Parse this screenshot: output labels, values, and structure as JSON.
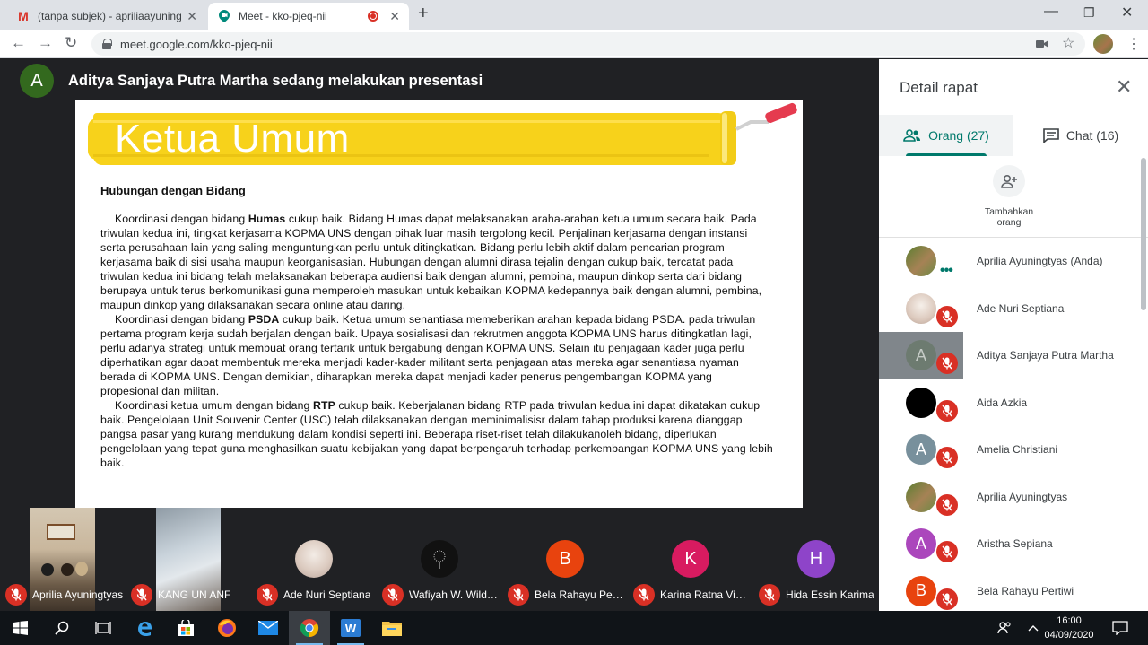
{
  "browser": {
    "tabs": [
      {
        "title": "(tanpa subjek) - apriliaayuningtyas",
        "icon": "gmail-icon",
        "active": false
      },
      {
        "title": "Meet - kko-pjeq-nii",
        "icon": "meet-icon",
        "active": true
      }
    ],
    "url": "meet.google.com/kko-pjeq-nii"
  },
  "stage": {
    "presenter_initial": "A",
    "presenter_text": "Aditya Sanjaya Putra Martha sedang melakukan presentasi"
  },
  "slide": {
    "banner_title": "Ketua Umum",
    "heading": "Hubungan dengan Bidang",
    "p1": {
      "a": "Koordinasi dengan bidang ",
      "b": "Humas",
      "c": " cukup baik. Bidang Humas dapat melaksanakan araha-arahan ketua umum secara baik. Pada triwulan kedua ini, tingkat kerjasama KOPMA UNS dengan pihak luar masih tergolong kecil. Penjalinan kerjasama dengan instansi serta perusahaan lain yang saling menguntungkan perlu untuk ditingkatkan. Bidang perlu lebih aktif dalam pencarian program kerjasama baik di sisi usaha maupun keorganisasian. Hubungan dengan alumni dirasa tejalin dengan cukup baik, tercatat pada triwulan kedua ini bidang telah melaksanakan beberapa audiensi baik dengan alumni, pembina, maupun dinkop serta dari bidang berupaya untuk terus berkomunikasi guna memperoleh masukan untuk kebaikan KOPMA kedepannya baik dengan alumni, pembina, maupun dinkop yang dilaksanakan secara online atau daring."
    },
    "p2": {
      "a": "Koordinasi dengan bidang ",
      "b": "PSDA",
      "c": " cukup baik. Ketua umum senantiasa memeberikan arahan kepada bidang PSDA. pada triwulan pertama program kerja sudah berjalan dengan baik. Upaya sosialisasi dan rekrutmen anggota KOPMA UNS harus ditingkatlan lagi, perlu adanya strategi untuk membuat orang tertarik untuk bergabung dengan KOPMA UNS. Selain itu penjagaan kader juga perlu diperhatikan agar dapat membentuk mereka menjadi kader-kader militant serta penjagaan atas mereka agar senantiasa nyaman berada di KOPMA UNS. Dengan demikian, diharapkan mereka dapat menjadi kader penerus pengembangan KOPMA yang propesional dan militan."
    },
    "p3": {
      "a": "Koordinasi ketua umum dengan bidang ",
      "b": "RTP",
      "c": " cukup baik. Keberjalanan bidang RTP pada triwulan kedua ini dapat dikatakan cukup baik. Pengelolaan Unit Souvenir Center (USC) telah dilaksanakan dengan meminimalisisr dalam tahap produksi karena dianggap pangsa pasar yang kurang mendukung dalam kondisi seperti ini. Beberapa riset-riset telah dilakukanoleh bidang, diperlukan pengelolaan yang tepat guna menghasilkan suatu kebijakan yang dapat berpengaruh terhadap perkembangan KOPMA UNS yang lebih baik."
    }
  },
  "filmstrip": [
    {
      "name": "Aprilia Ayuningtyas",
      "type": "video",
      "color": "#8a7a66"
    },
    {
      "name": "KANG UN ANF",
      "type": "video",
      "color": "#b7c4cf"
    },
    {
      "name": "Ade Nuri Septiana",
      "type": "photo",
      "color": "#e8dcd4"
    },
    {
      "name": "Wafiyah W. Wildana",
      "type": "photo",
      "color": "#111111"
    },
    {
      "name": "Bela Rahayu Pertiwi",
      "type": "initial",
      "initial": "B",
      "color": "#e8430e"
    },
    {
      "name": "Karina Ratna Vinanda",
      "type": "initial",
      "initial": "K",
      "color": "#d81b60"
    },
    {
      "name": "Hida Essin Karima",
      "type": "initial",
      "initial": "H",
      "color": "#8e44c9"
    }
  ],
  "panel": {
    "title": "Detail rapat",
    "tab_people": "Orang (27)",
    "tab_chat": "Chat (16)",
    "add_label_1": "Tambahkan",
    "add_label_2": "orang",
    "participants": [
      {
        "name": "Aprilia Ayuningtyas (Anda)",
        "type": "photo",
        "color": "#6b8e3a",
        "muted": false
      },
      {
        "name": "Ade Nuri Septiana",
        "type": "photo",
        "color": "#e8dcd4",
        "muted": true
      },
      {
        "name": "Aditya Sanjaya Putra Martha",
        "type": "initial",
        "initial": "A",
        "color": "#6d7b70",
        "muted": true,
        "highlighted": true
      },
      {
        "name": "Aida Azkia",
        "type": "photo",
        "color": "#000000",
        "muted": true
      },
      {
        "name": "Amelia Christiani",
        "type": "initial",
        "initial": "A",
        "color": "#78909c",
        "muted": true
      },
      {
        "name": "Aprilia Ayuningtyas",
        "type": "photo",
        "color": "#6b8e3a",
        "muted": true
      },
      {
        "name": "Aristha Sepiana",
        "type": "initial",
        "initial": "A",
        "color": "#ab47bc",
        "muted": true
      },
      {
        "name": "Bela Rahayu Pertiwi",
        "type": "initial",
        "initial": "B",
        "color": "#e8430e",
        "muted": true
      }
    ]
  },
  "taskbar": {
    "time": "16:00",
    "date": "04/09/2020"
  }
}
